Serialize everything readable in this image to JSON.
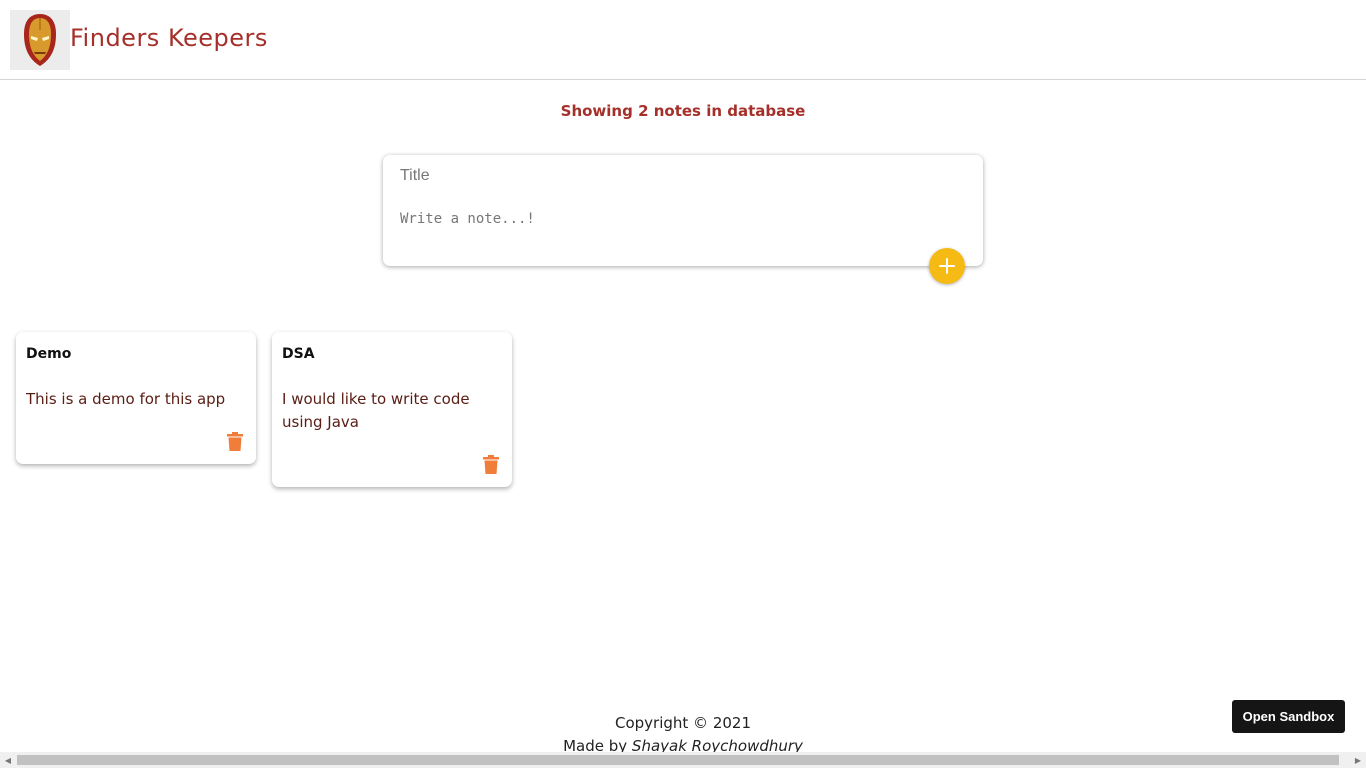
{
  "header": {
    "title": "Finders Keepers",
    "logo_icon": "iron-man-mask-icon"
  },
  "main": {
    "count_text": "Showing 2 notes in database"
  },
  "compose": {
    "title_placeholder": "Title",
    "title_value": "",
    "content_placeholder": "Write a note...!",
    "content_value": "",
    "add_icon": "plus-icon"
  },
  "notes": [
    {
      "title": "Demo",
      "content": "This is a demo for this app"
    },
    {
      "title": "DSA",
      "content": "I would like to write code using Java"
    }
  ],
  "footer": {
    "copyright": "Copyright © 2021",
    "made_by": "Made by",
    "author": "Shayak Roychowdhury"
  },
  "sandbox": {
    "label": "Open Sandbox"
  },
  "colors": {
    "brand": "#a5302a",
    "accent": "#f5ba13",
    "delete": "#f07d3a"
  }
}
